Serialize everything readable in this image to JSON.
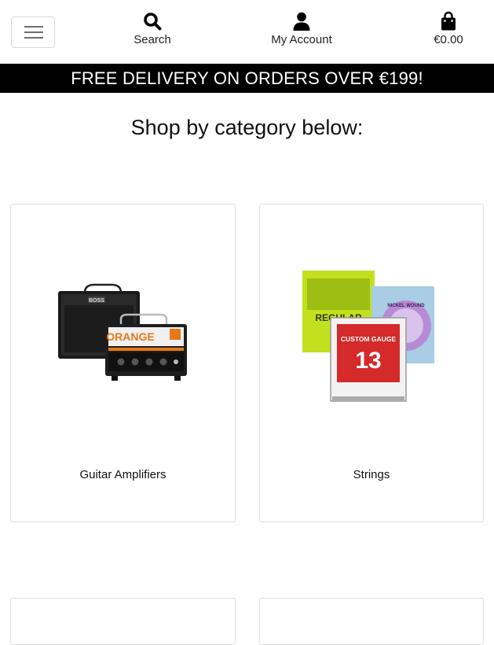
{
  "header": {
    "menu_toggle_icon": "hamburger-menu-icon",
    "nav": {
      "search": {
        "label": "Search",
        "icon": "search-icon"
      },
      "account": {
        "label": "My Account",
        "icon": "user-icon"
      },
      "bag": {
        "label": "€0.00",
        "icon": "shopping-bag-icon"
      }
    }
  },
  "banner": {
    "text": "FREE DELIVERY ON ORDERS OVER €199!",
    "background": "#000000",
    "color": "#ffffff"
  },
  "main": {
    "heading": "Shop by category below:",
    "categories": [
      {
        "label": "Guitar Amplifiers",
        "image": "guitar-amplifiers-image",
        "image_text": [
          "BOSS",
          "ORANGE"
        ]
      },
      {
        "label": "Strings",
        "image": "guitar-strings-image",
        "image_text": [
          "REGULAR",
          "NICKEL WOUND",
          "CUSTOM GAUGE",
          "13"
        ]
      },
      {
        "label": "",
        "image": ""
      },
      {
        "label": "",
        "image": ""
      }
    ]
  }
}
